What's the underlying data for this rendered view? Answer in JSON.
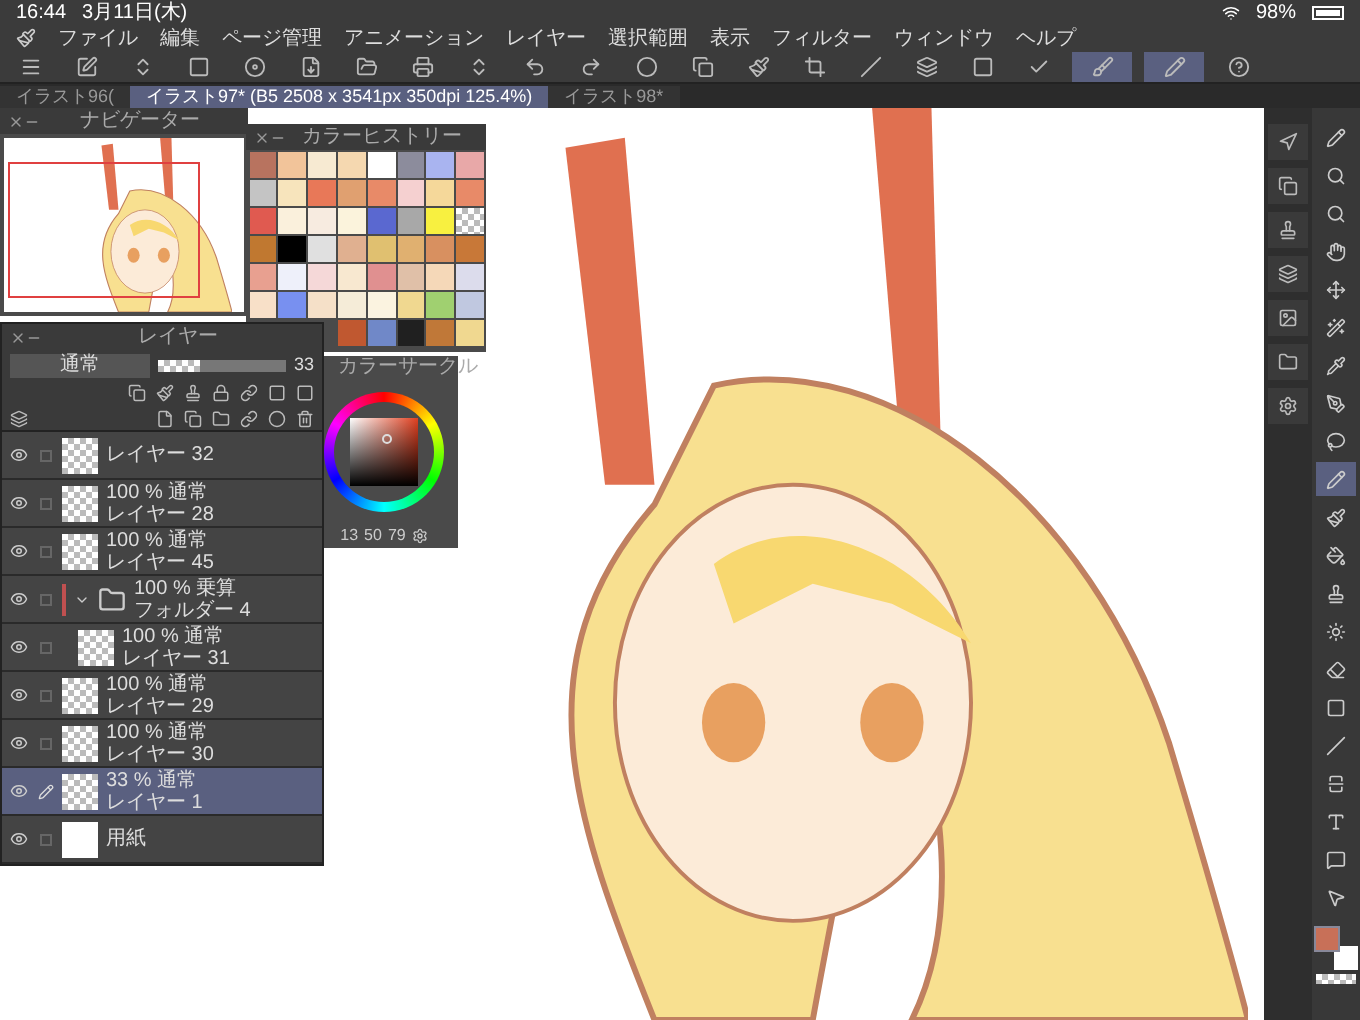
{
  "status_bar": {
    "time": "16:44",
    "date": "3月11日(木)",
    "battery": "98%"
  },
  "menu": [
    "ファイル",
    "編集",
    "ページ管理",
    "アニメーション",
    "レイヤー",
    "選択範囲",
    "表示",
    "フィルター",
    "ウィンドウ",
    "ヘルプ"
  ],
  "toolbar": [
    {
      "selected": false
    },
    {
      "selected": false
    },
    {
      "selected": false
    },
    {
      "selected": false
    },
    {
      "selected": false
    },
    {
      "selected": false
    },
    {
      "selected": false
    },
    {
      "selected": false
    },
    {
      "selected": false
    },
    {
      "selected": false
    },
    {
      "selected": false
    },
    {
      "selected": false
    },
    {
      "selected": false
    },
    {
      "selected": false
    },
    {
      "selected": false
    },
    {
      "selected": false
    },
    {
      "selected": false
    },
    {
      "selected": false
    },
    {
      "selected": false
    },
    {
      "selected": true
    },
    {
      "selected": true
    },
    {
      "selected": false
    }
  ],
  "tabs": [
    {
      "label": "イラスト96(",
      "selected": false
    },
    {
      "label": "イラスト97* (B5 2508 x 3541px 350dpi 125.4%)",
      "selected": true
    },
    {
      "label": "イラスト98*",
      "selected": false
    }
  ],
  "navigator": {
    "title": "ナビゲーター"
  },
  "color_history": {
    "title": "カラーヒストリー",
    "swatches": [
      {
        "kind": "color",
        "color": "#b8735f"
      },
      {
        "kind": "color",
        "color": "#f2c49a"
      },
      {
        "kind": "color",
        "color": "#f7ead2"
      },
      {
        "kind": "color",
        "color": "#f5d8b0"
      },
      {
        "kind": "color",
        "color": "#ffffff"
      },
      {
        "kind": "color",
        "color": "#8c8c9c"
      },
      {
        "kind": "color",
        "color": "#a9b4f0"
      },
      {
        "kind": "color",
        "color": "#e8a8a8"
      },
      {
        "kind": "color",
        "color": "#c4c4c4"
      },
      {
        "kind": "color",
        "color": "#f7e4bc"
      },
      {
        "kind": "color",
        "color": "#e87858"
      },
      {
        "kind": "color",
        "color": "#e0a070"
      },
      {
        "kind": "color",
        "color": "#e88a68"
      },
      {
        "kind": "color",
        "color": "#f5d0d0"
      },
      {
        "kind": "color",
        "color": "#f5d89a"
      },
      {
        "kind": "color",
        "color": "#e88a68"
      },
      {
        "kind": "color",
        "color": "#e05a50"
      },
      {
        "kind": "color",
        "color": "#faf0dc"
      },
      {
        "kind": "color",
        "color": "#f7ebe0"
      },
      {
        "kind": "color",
        "color": "#fbf3dc"
      },
      {
        "kind": "color",
        "color": "#5a68d0"
      },
      {
        "kind": "color",
        "color": "#a8a8a8"
      },
      {
        "kind": "color",
        "color": "#f8f040"
      },
      {
        "kind": "transparent"
      },
      {
        "kind": "color",
        "color": "#c07830"
      },
      {
        "kind": "color",
        "color": "#000000"
      },
      {
        "kind": "color",
        "color": "#e0e0e0"
      },
      {
        "kind": "color",
        "color": "#e0b090"
      },
      {
        "kind": "color",
        "color": "#e0c070"
      },
      {
        "kind": "color",
        "color": "#e0b070"
      },
      {
        "kind": "color",
        "color": "#d89060"
      },
      {
        "kind": "color",
        "color": "#c87838"
      },
      {
        "kind": "color",
        "color": "#e8a090"
      },
      {
        "kind": "color",
        "color": "#eef0fa"
      },
      {
        "kind": "color",
        "color": "#f5d8d8"
      },
      {
        "kind": "color",
        "color": "#f8e8d0"
      },
      {
        "kind": "color",
        "color": "#e09090"
      },
      {
        "kind": "color",
        "color": "#e0c0a8"
      },
      {
        "kind": "color",
        "color": "#f5d8b8"
      },
      {
        "kind": "color",
        "color": "#dcdcec"
      },
      {
        "kind": "color",
        "color": "#f8e0c8"
      },
      {
        "kind": "color",
        "color": "#7890f0"
      },
      {
        "kind": "color",
        "color": "#f5e0c8"
      },
      {
        "kind": "color",
        "color": "#f5ecd8"
      },
      {
        "kind": "color",
        "color": "#fbf3e0"
      },
      {
        "kind": "color",
        "color": "#f0d890"
      },
      {
        "kind": "color",
        "color": "#a0d070"
      },
      {
        "kind": "color",
        "color": "#c0c8e0"
      },
      {
        "kind": "color",
        "color": "#c05830"
      },
      {
        "kind": "color",
        "color": "#7088c8"
      },
      {
        "kind": "color",
        "color": "#202020"
      },
      {
        "kind": "color",
        "color": "#c07838"
      },
      {
        "kind": "color",
        "color": "#f0d890"
      }
    ]
  },
  "color_circle": {
    "title": "カラーサークル",
    "values": [
      "13",
      "50",
      "79"
    ]
  },
  "layers": {
    "title": "レイヤー",
    "blend_mode": "通常",
    "opacity": "33",
    "opacity_slider": {
      "level": 0.33
    },
    "items": [
      {
        "kind": "layer",
        "name": "レイヤー 32",
        "visible": true,
        "selected": false
      },
      {
        "kind": "layer",
        "mode": "100 % 通常",
        "name": "レイヤー 28",
        "visible": true,
        "selected": false
      },
      {
        "kind": "layer",
        "mode": "100 % 通常",
        "name": "レイヤー 45",
        "visible": true,
        "selected": false
      },
      {
        "kind": "folder",
        "mode": "100 % 乗算",
        "name": "フォルダー 4",
        "visible": true,
        "selected": false,
        "expanded": true,
        "color": "#c05050",
        "children": [
          {
            "kind": "layer",
            "mode": "100 % 通常",
            "name": "レイヤー 31",
            "visible": true,
            "selected": false
          }
        ]
      },
      {
        "kind": "layer",
        "mode": "100 % 通常",
        "name": "レイヤー 29",
        "visible": true,
        "selected": false
      },
      {
        "kind": "layer",
        "mode": "100 % 通常",
        "name": "レイヤー 30",
        "visible": true,
        "selected": false
      },
      {
        "kind": "layer",
        "mode": "33 % 通常",
        "name": "レイヤー 1",
        "visible": true,
        "selected": true
      },
      {
        "kind": "paper",
        "name": "用紙",
        "visible": true,
        "selected": false
      }
    ]
  },
  "commands": [
    {
      "selected": false
    },
    {
      "selected": false
    },
    {
      "selected": false
    },
    {
      "selected": false
    },
    {
      "selected": false
    },
    {
      "selected": false
    },
    {
      "selected": false
    }
  ],
  "tools": [
    {
      "selected": false
    },
    {
      "selected": false
    },
    {
      "selected": false
    },
    {
      "selected": false
    },
    {
      "selected": false
    },
    {
      "selected": false
    },
    {
      "selected": false
    },
    {
      "selected": false
    },
    {
      "selected": false
    },
    {
      "selected": true
    },
    {
      "selected": false
    },
    {
      "selected": false
    },
    {
      "selected": false
    },
    {
      "selected": false
    },
    {
      "selected": false
    },
    {
      "selected": false
    },
    {
      "selected": false
    },
    {
      "selected": false
    },
    {
      "selected": false
    },
    {
      "selected": false
    },
    {
      "selected": false
    }
  ],
  "colors": [
    {
      "kind": "main",
      "color": "#c87058"
    },
    {
      "kind": "sub",
      "color": "#ffffff"
    }
  ]
}
